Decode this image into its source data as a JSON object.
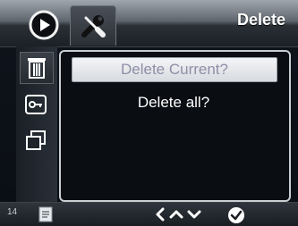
{
  "header": {
    "title": "Delete",
    "tabs": [
      {
        "icon": "play-icon"
      },
      {
        "icon": "tools-icon"
      }
    ]
  },
  "sidebar": {
    "items": [
      {
        "icon": "trash-icon",
        "active": true
      },
      {
        "icon": "key-icon"
      },
      {
        "icon": "copy-icon"
      }
    ]
  },
  "menu": {
    "options": [
      {
        "label": "Delete Current?",
        "selected": true
      },
      {
        "label": "Delete all?"
      }
    ]
  },
  "footer": {
    "counter": "14",
    "icons": [
      "memo-icon",
      "navigate-left-icon",
      "navigate-up-icon",
      "navigate-down-icon",
      "confirm-icon"
    ]
  },
  "colors": {
    "selected_text": "#8f8ea6",
    "title_text": "#ffffff"
  }
}
